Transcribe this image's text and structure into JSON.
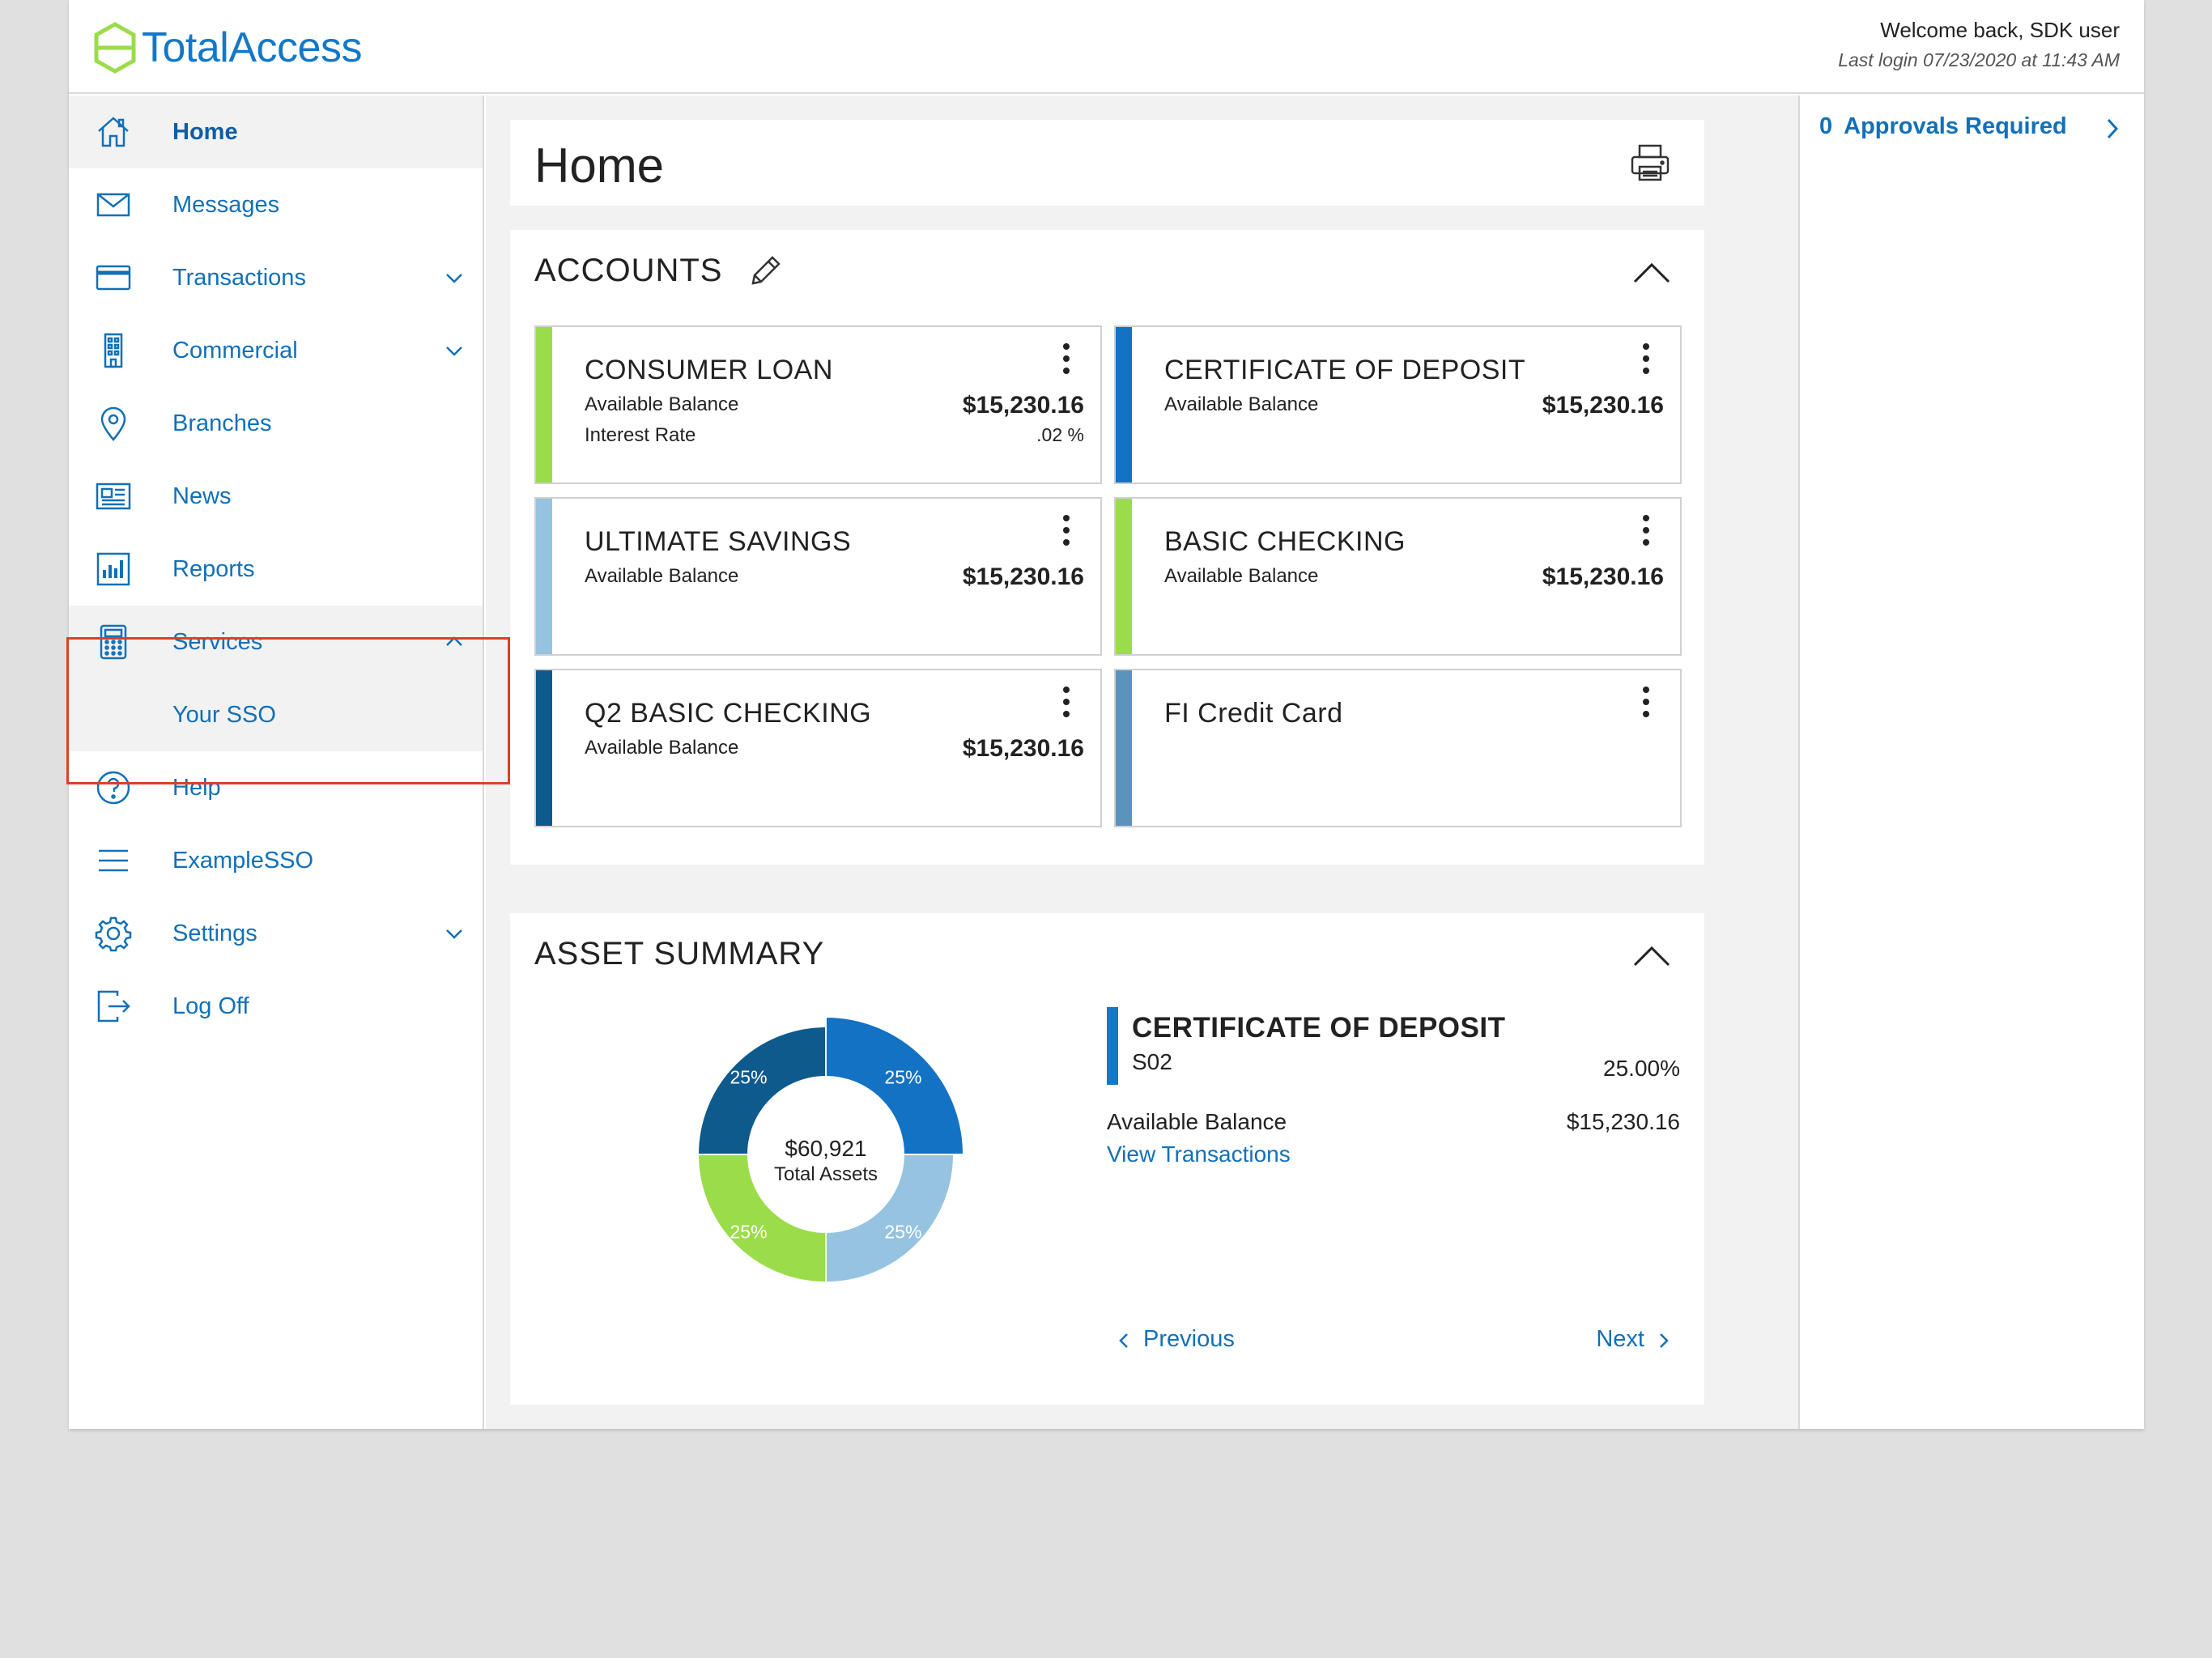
{
  "header": {
    "logo_text": "TotalAccess",
    "welcome": "Welcome back, SDK user",
    "last_login": "Last login 07/23/2020 at 11:43 AM"
  },
  "sidebar": {
    "items": [
      {
        "label": "Home",
        "icon": "home-icon"
      },
      {
        "label": "Messages",
        "icon": "mail-icon"
      },
      {
        "label": "Transactions",
        "icon": "card-icon"
      },
      {
        "label": "Commercial",
        "icon": "building-icon"
      },
      {
        "label": "Branches",
        "icon": "location-pin-icon"
      },
      {
        "label": "News",
        "icon": "newspaper-icon"
      },
      {
        "label": "Reports",
        "icon": "bar-chart-icon"
      },
      {
        "label": "Services",
        "icon": "calculator-icon"
      },
      {
        "label": "Your SSO",
        "icon": ""
      },
      {
        "label": "Help",
        "icon": "help-icon"
      },
      {
        "label": "ExampleSSO",
        "icon": "menu-lines-icon"
      },
      {
        "label": "Settings",
        "icon": "gear-icon"
      },
      {
        "label": "Log Off",
        "icon": "logout-icon"
      }
    ]
  },
  "main": {
    "page_title": "Home",
    "accounts": {
      "title": "ACCOUNTS",
      "cards": [
        {
          "name": "CONSUMER LOAN",
          "label1": "Available Balance",
          "value1": "$15,230.16",
          "label2": "Interest Rate",
          "value2": ".02 %",
          "color": "#9bdc4a"
        },
        {
          "name": "CERTIFICATE OF DEPOSIT",
          "label1": "Available Balance",
          "value1": "$15,230.16",
          "label2": "",
          "value2": "",
          "color": "#1472c4"
        },
        {
          "name": "ULTIMATE SAVINGS",
          "label1": "Available Balance",
          "value1": "$15,230.16",
          "label2": "",
          "value2": "",
          "color": "#95c3e0"
        },
        {
          "name": "BASIC CHECKING",
          "label1": "Available Balance",
          "value1": "$15,230.16",
          "label2": "",
          "value2": "",
          "color": "#9bdc4a"
        },
        {
          "name": "Q2 BASIC CHECKING",
          "label1": "Available Balance",
          "value1": "$15,230.16",
          "label2": "",
          "value2": "",
          "color": "#0e5a8c"
        },
        {
          "name": "FI Credit Card",
          "label1": "",
          "value1": "",
          "label2": "",
          "value2": "",
          "color": "#5b93bd"
        }
      ]
    },
    "asset_summary": {
      "title": "ASSET SUMMARY",
      "total_value": "$60,921",
      "total_label": "Total Assets",
      "segments": [
        {
          "label": "25%",
          "value": 25,
          "color": "#1472c4"
        },
        {
          "label": "25%",
          "value": 25,
          "color": "#95c3e0"
        },
        {
          "label": "25%",
          "value": 25,
          "color": "#9bdc4a"
        },
        {
          "label": "25%",
          "value": 25,
          "color": "#0e5a8c"
        }
      ],
      "detail": {
        "title": "CERTIFICATE OF DEPOSIT",
        "subtitle": "S02",
        "percent": "25.00%",
        "balance_label": "Available Balance",
        "balance": "$15,230.16",
        "link": "View Transactions"
      },
      "previous": "Previous",
      "next": "Next"
    }
  },
  "right_panel": {
    "approvals_count": "0",
    "approvals_label": "Approvals Required"
  }
}
